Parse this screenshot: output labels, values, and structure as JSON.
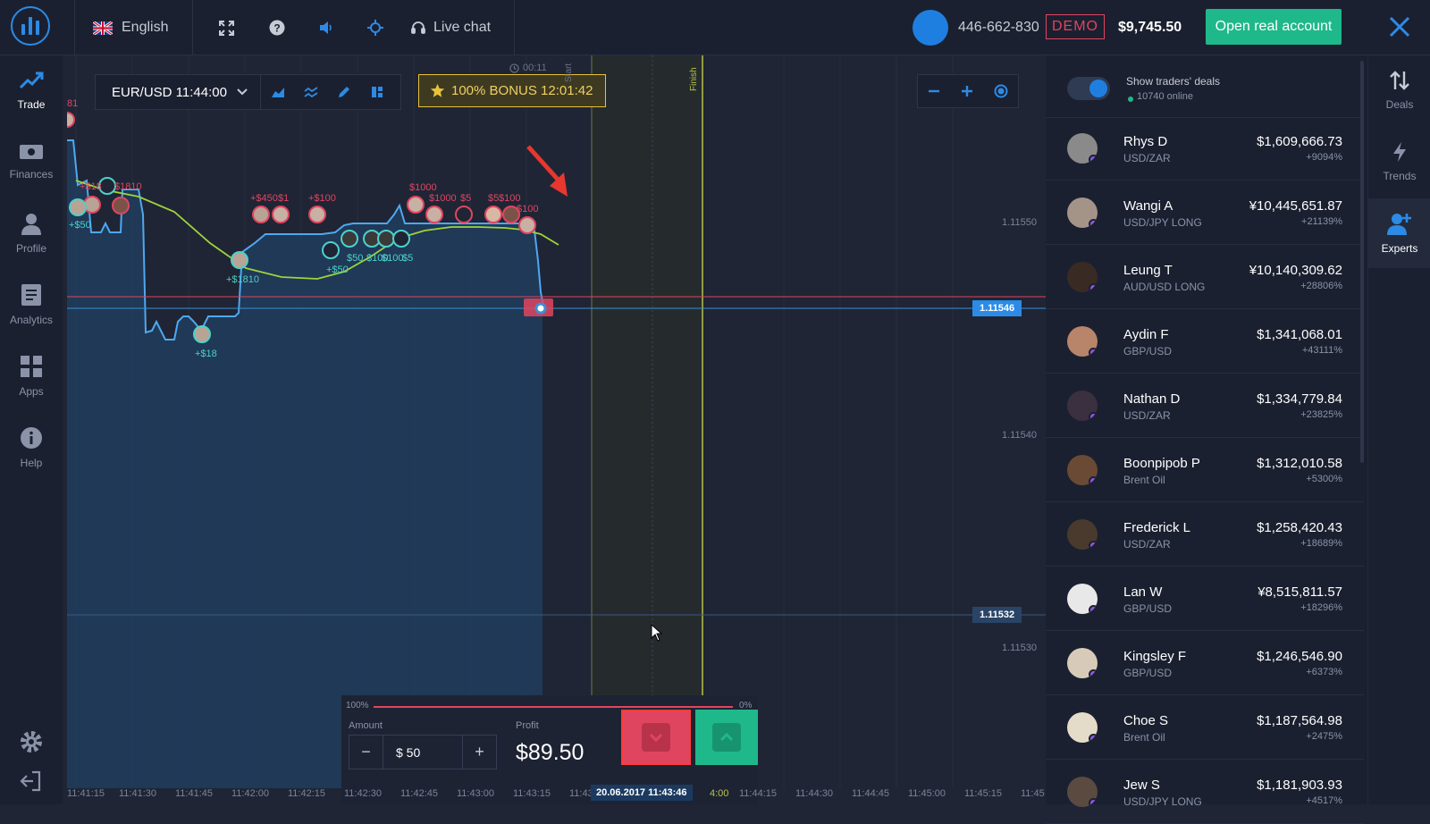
{
  "topbar": {
    "language": "English",
    "live_chat": "Live chat",
    "account_id": "446-662-830",
    "demo_badge": "DEMO",
    "balance": "$9,745.50",
    "open_real_label": "Open real account"
  },
  "leftnav": [
    {
      "label": "Trade",
      "icon": "trade-chart-icon"
    },
    {
      "label": "Finances",
      "icon": "cash-icon"
    },
    {
      "label": "Profile",
      "icon": "user-icon"
    },
    {
      "label": "Analytics",
      "icon": "document-icon"
    },
    {
      "label": "Apps",
      "icon": "grid-icon"
    },
    {
      "label": "Help",
      "icon": "info-icon"
    }
  ],
  "chart_toolbar": {
    "asset": "EUR/USD 11:44:00",
    "bonus": "100% BONUS 12:01:42",
    "timer": "00:11",
    "start_label": "Start",
    "finish_label": "Finish"
  },
  "price_axis": {
    "levels": [
      "1.11550",
      "1.11540",
      "1.11530"
    ],
    "current_price": "1.11546",
    "line_price": "1.11532"
  },
  "time_axis": [
    "11:41:15",
    "11:41:30",
    "11:41:45",
    "11:42:00",
    "11:42:15",
    "11:42:30",
    "11:42:45",
    "11:43:00",
    "11:43:15",
    "11:43:3",
    "20.06.2017 11:43:46",
    "4:00",
    "11:44:15",
    "11:44:30",
    "11:44:45",
    "11:45:00",
    "11:45:15",
    "11:45"
  ],
  "deal_labels": [
    "+$18",
    "$1810",
    "+$450",
    "$1",
    "+$100",
    "$1000",
    "$1000",
    "$5",
    "$5",
    "$100",
    "$100",
    "+$1810",
    "+$50",
    "$50",
    "$100",
    "$100",
    "$5",
    "+$18",
    "+$50",
    "81"
  ],
  "trade_panel": {
    "pct_left": "100%",
    "pct_right": "0%",
    "amount_label": "Amount",
    "amount_value": "$ 50",
    "profit_label": "Profit",
    "profit_value": "$89.50"
  },
  "traders_header": {
    "toggle_label": "Show traders' deals",
    "online": "10740 online"
  },
  "traders": [
    {
      "name": "Rhys D",
      "pair": "USD/ZAR",
      "amount": "$1,609,666.73",
      "pct": "+9094%"
    },
    {
      "name": "Wangi A",
      "pair": "USD/JPY LONG",
      "amount": "¥10,445,651.87",
      "pct": "+21139%"
    },
    {
      "name": "Leung T",
      "pair": "AUD/USD LONG",
      "amount": "¥10,140,309.62",
      "pct": "+28806%"
    },
    {
      "name": "Aydin F",
      "pair": "GBP/USD",
      "amount": "$1,341,068.01",
      "pct": "+43111%"
    },
    {
      "name": "Nathan D",
      "pair": "USD/ZAR",
      "amount": "$1,334,779.84",
      "pct": "+23825%"
    },
    {
      "name": "Boonpipob P",
      "pair": "Brent Oil",
      "amount": "$1,312,010.58",
      "pct": "+5300%"
    },
    {
      "name": "Frederick L",
      "pair": "USD/ZAR",
      "amount": "$1,258,420.43",
      "pct": "+18689%"
    },
    {
      "name": "Lan W",
      "pair": "GBP/USD",
      "amount": "¥8,515,811.57",
      "pct": "+18296%"
    },
    {
      "name": "Kingsley F",
      "pair": "GBP/USD",
      "amount": "$1,246,546.90",
      "pct": "+6373%"
    },
    {
      "name": "Choe S",
      "pair": "Brent Oil",
      "amount": "$1,187,564.98",
      "pct": "+2475%"
    },
    {
      "name": "Jew S",
      "pair": "USD/JPY LONG",
      "amount": "$1,181,903.93",
      "pct": "+4517%"
    }
  ],
  "rightrail": [
    {
      "label": "Deals",
      "icon": "arrows-updown-icon"
    },
    {
      "label": "Trends",
      "icon": "lightning-icon"
    },
    {
      "label": "Experts",
      "icon": "add-user-icon"
    }
  ],
  "colors": {
    "accent_blue": "#2c8be6",
    "green": "#1fb88a",
    "red": "#e0455f",
    "demo_red": "#e0455f",
    "bonus_yellow": "#e8c23a",
    "trend_line": "#9fd33a"
  }
}
